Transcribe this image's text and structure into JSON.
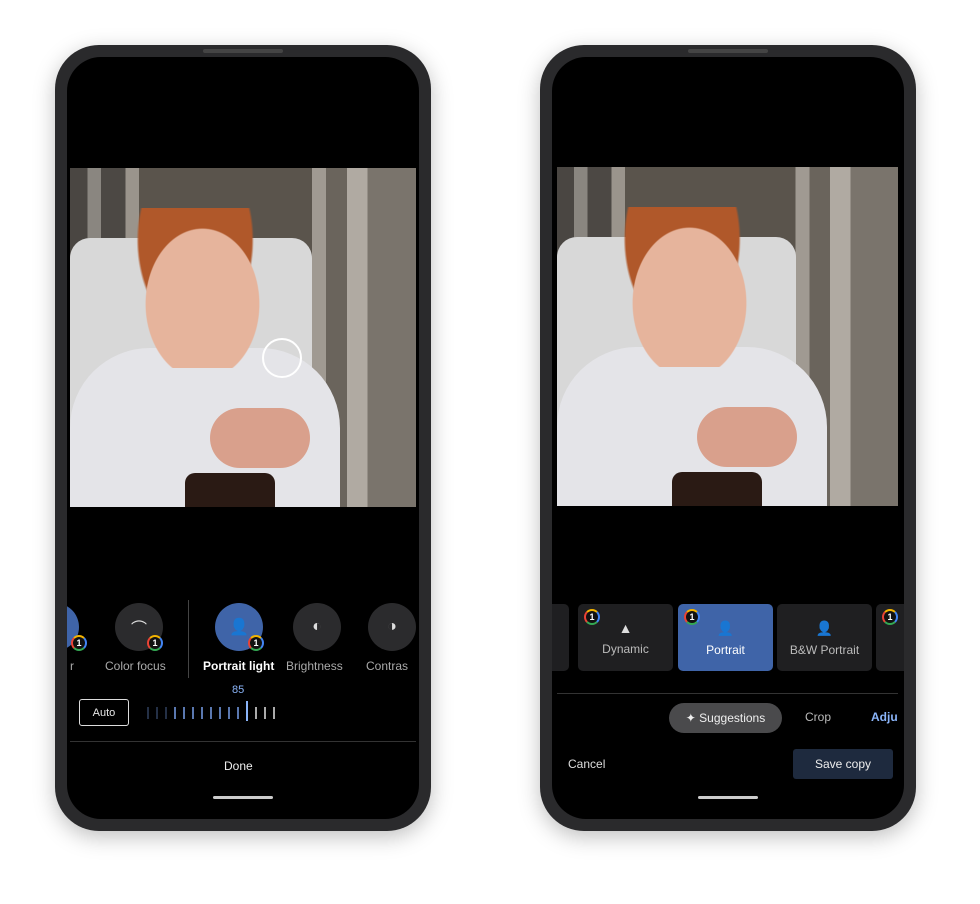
{
  "left_phone": {
    "tools": [
      {
        "label": "r",
        "icon": "partial-tool-icon",
        "badge": "1"
      },
      {
        "label": "Color focus",
        "icon": "color-focus-icon",
        "badge": "1"
      },
      {
        "label": "Portrait light",
        "icon": "portrait-light-icon",
        "badge": "1",
        "selected": true
      },
      {
        "label": "Brightness",
        "icon": "brightness-icon"
      },
      {
        "label": "Contras",
        "icon": "contrast-icon"
      }
    ],
    "slider_value": "85",
    "auto_label": "Auto",
    "done_label": "Done"
  },
  "right_phone": {
    "suggestions": [
      {
        "label": "Dynamic",
        "icon": "mountain-icon",
        "badge": "1"
      },
      {
        "label": "Portrait",
        "icon": "person-icon",
        "badge": "1",
        "selected": true
      },
      {
        "label": "B&W Portrait",
        "icon": "person-icon"
      },
      {
        "label": "",
        "badge": "1"
      }
    ],
    "tabs": [
      {
        "label": "✦ Suggestions",
        "active": true
      },
      {
        "label": "Crop"
      },
      {
        "label": "Adju"
      }
    ],
    "cancel_label": "Cancel",
    "save_label": "Save copy"
  },
  "colors": {
    "accent": "#3f64a8",
    "accent_text": "#8ab4f8",
    "save_bg": "#1e2a3e"
  }
}
